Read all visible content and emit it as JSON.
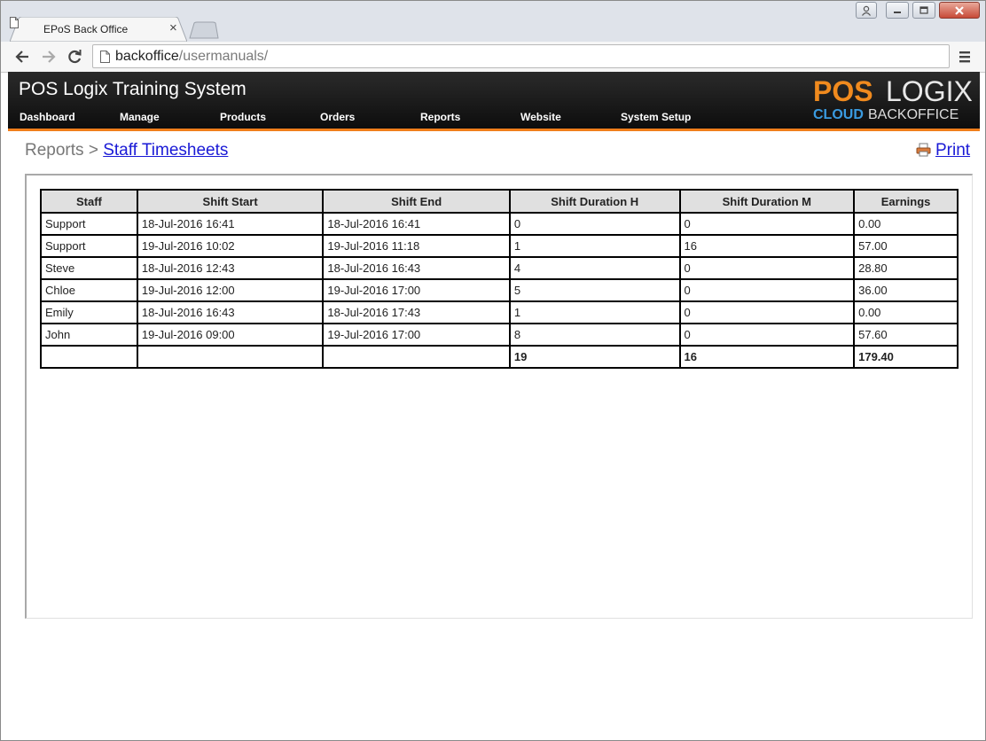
{
  "browser": {
    "tab_title": "EPoS Back Office",
    "url_host": "backoffice",
    "url_path": "/usermanuals/"
  },
  "app": {
    "title": "POS Logix Training System",
    "nav": [
      "Dashboard",
      "Manage",
      "Products",
      "Orders",
      "Reports",
      "Website",
      "System Setup"
    ],
    "logo": {
      "pos": "POS",
      "logix": "LOGIX",
      "cloud": "CLOUD",
      "backoffice": "BACKOFFICE"
    },
    "accent_color": "#f07e1b"
  },
  "breadcrumb": {
    "parent": "Reports",
    "separator": ">",
    "current": "Staff Timesheets"
  },
  "print_label": "Print",
  "table": {
    "headers": [
      "Staff",
      "Shift Start",
      "Shift End",
      "Shift Duration H",
      "Shift Duration M",
      "Earnings"
    ],
    "rows": [
      [
        "Support",
        "18-Jul-2016 16:41",
        "18-Jul-2016 16:41",
        "0",
        "0",
        "0.00"
      ],
      [
        "Support",
        "19-Jul-2016 10:02",
        "19-Jul-2016 11:18",
        "1",
        "16",
        "57.00"
      ],
      [
        "Steve",
        "18-Jul-2016 12:43",
        "18-Jul-2016 16:43",
        "4",
        "0",
        "28.80"
      ],
      [
        "Chloe",
        "19-Jul-2016 12:00",
        "19-Jul-2016 17:00",
        "5",
        "0",
        "36.00"
      ],
      [
        "Emily",
        "18-Jul-2016 16:43",
        "18-Jul-2016 17:43",
        "1",
        "0",
        "0.00"
      ],
      [
        "John",
        "19-Jul-2016 09:00",
        "19-Jul-2016 17:00",
        "8",
        "0",
        "57.60"
      ]
    ],
    "totals": [
      "",
      "",
      "",
      "19",
      "16",
      "179.40"
    ]
  }
}
